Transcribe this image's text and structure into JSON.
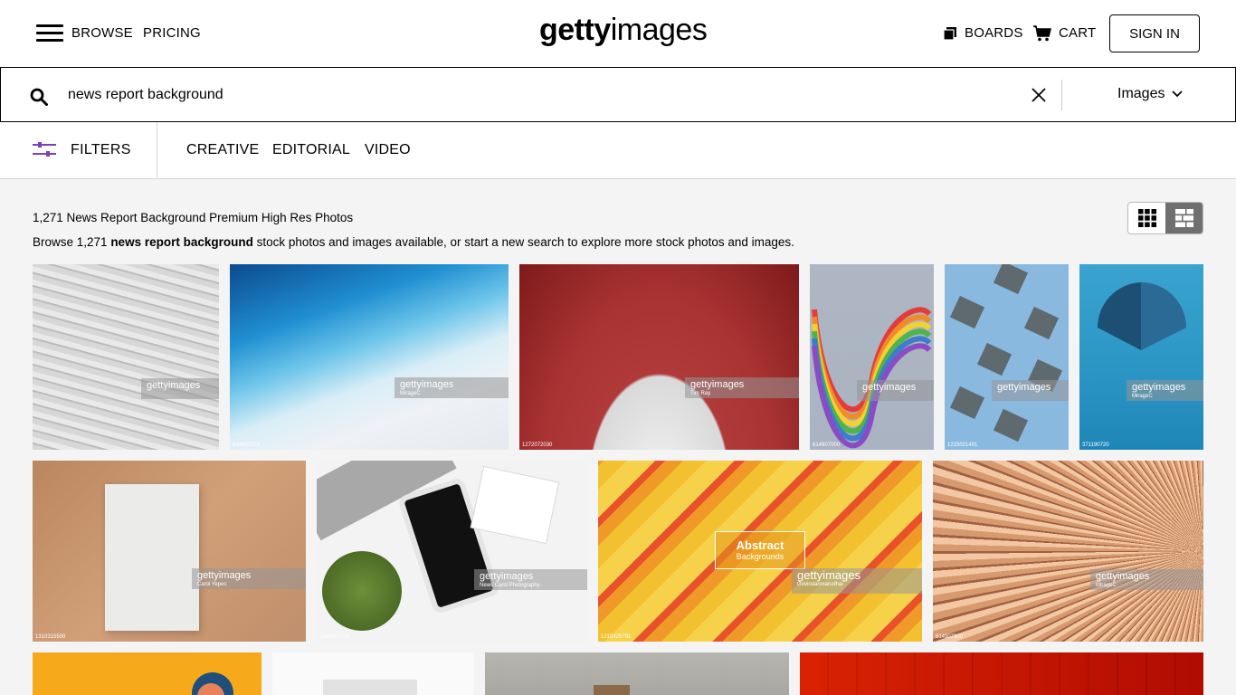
{
  "header": {
    "menu_label": "BROWSE",
    "pricing_label": "PRICING",
    "logo_bold": "getty",
    "logo_thin": "images",
    "boards_label": "BOARDS",
    "cart_label": "CART",
    "signin_label": "SIGN IN"
  },
  "search": {
    "query": "news report background",
    "type_label": "Images"
  },
  "filters": {
    "label": "FILTERS",
    "tabs": [
      "CREATIVE",
      "EDITORIAL",
      "VIDEO"
    ]
  },
  "results": {
    "title": "1,271 News Report Background Premium High Res Photos",
    "desc_prefix": "Browse 1,271 ",
    "desc_bold": "news report background",
    "desc_suffix": " stock photos and images available, or start a new search to explore more stock photos and images."
  },
  "images": [
    {
      "watermark": "gettyimages",
      "credit": "",
      "id": ""
    },
    {
      "watermark": "gettyimages",
      "credit": "MirageC",
      "id": "614907372"
    },
    {
      "watermark": "gettyimages",
      "credit": "Tim Ray",
      "id": "1272072030"
    },
    {
      "watermark": "gettyimages",
      "credit": "",
      "id": "614907000"
    },
    {
      "watermark": "gettyimages",
      "credit": "",
      "id": "1215021401"
    },
    {
      "watermark": "gettyimages",
      "credit": "MirageC",
      "id": "371190720"
    },
    {
      "watermark": "gettyimages",
      "credit": "Carol Yepes",
      "id": "1310315500"
    },
    {
      "watermark": "gettyimages",
      "credit": "News Carol Photography",
      "id": "1268427744"
    },
    {
      "watermark": "gettyimages",
      "credit": "Govindanmarudhai",
      "id": "1215425791",
      "title": "Abstract",
      "subtitle": "Backgrounds"
    },
    {
      "watermark": "gettyimages",
      "credit": "MirageC",
      "id": "614907300"
    }
  ]
}
